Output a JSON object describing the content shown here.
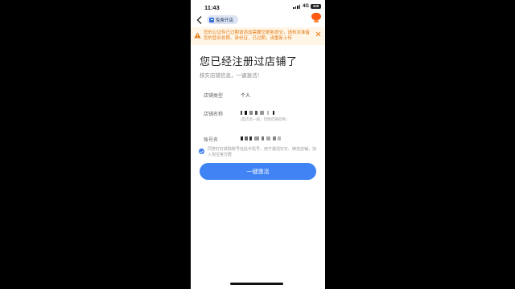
{
  "status_bar": {
    "time": "11:43",
    "network": "4G",
    "battery": "100"
  },
  "nav": {
    "chip_label": "免费开店"
  },
  "warning": {
    "text": "您的公证件已过期请添加需要您更新提交，请核对准备您的营业执照、身份证、已过期，请重新上传"
  },
  "page": {
    "title": "您已经注册过店铺了",
    "subtitle": "核实店铺信息，一键激活！"
  },
  "form": {
    "shop_type_label": "店铺类型",
    "shop_type_value": "个人",
    "shop_name_label": "店铺名称",
    "shop_name_hint": "(是店名一般，可改店铺名称)",
    "account_label": "账号名"
  },
  "agreement": {
    "text": "同意钉钉获取账号在此手机号，用于激活钉钉、绑定店铺，加入淘宝官方群"
  },
  "cta": {
    "label": "一键激活"
  },
  "colors": {
    "accent": "#3f83f4",
    "warning": "#e57a12",
    "warning_bg": "#fff6e8"
  }
}
